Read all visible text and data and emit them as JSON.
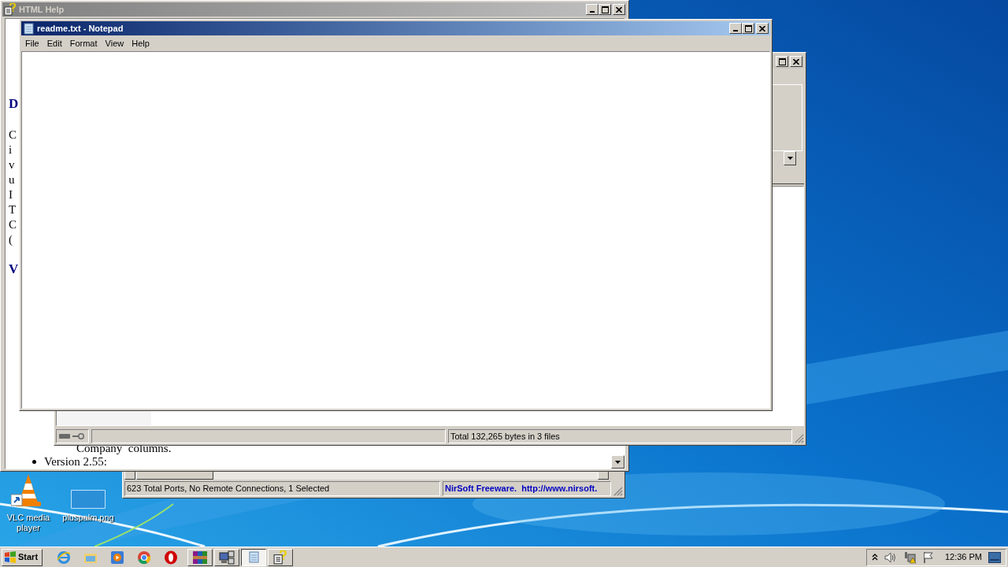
{
  "html_help_window": {
    "title": "HTML Help",
    "active": false,
    "headings": [
      "D",
      "V"
    ],
    "fragments": [
      "C",
      "i",
      "v",
      "u",
      "I",
      "T",
      "C",
      "("
    ],
    "bottom_text": "Company  columns.",
    "bullet": "Version 2.55:"
  },
  "file_window": {
    "status_text": "Total 132,265 bytes in 3 files"
  },
  "currports_window": {
    "status_bar": [
      {
        "text": "623 Total Ports, No Remote Connections, 1 Selected",
        "kind": "plain"
      },
      {
        "text": "NirSoft Freeware.  http://www.nirsoft.",
        "kind": "link"
      }
    ]
  },
  "notepad_window": {
    "title": "readme.txt - Notepad",
    "active": true,
    "menu": [
      "File",
      "Edit",
      "Format",
      "View",
      "Help"
    ]
  },
  "desktop_icons": [
    {
      "label": "VLC media player"
    },
    {
      "label": "pluspalm.png"
    }
  ],
  "taskbar": {
    "start": "Start",
    "tasks": [
      {
        "selected": false
      },
      {
        "selected": false
      },
      {
        "selected": true
      },
      {
        "selected": false
      }
    ],
    "clock": "12:36 PM"
  }
}
